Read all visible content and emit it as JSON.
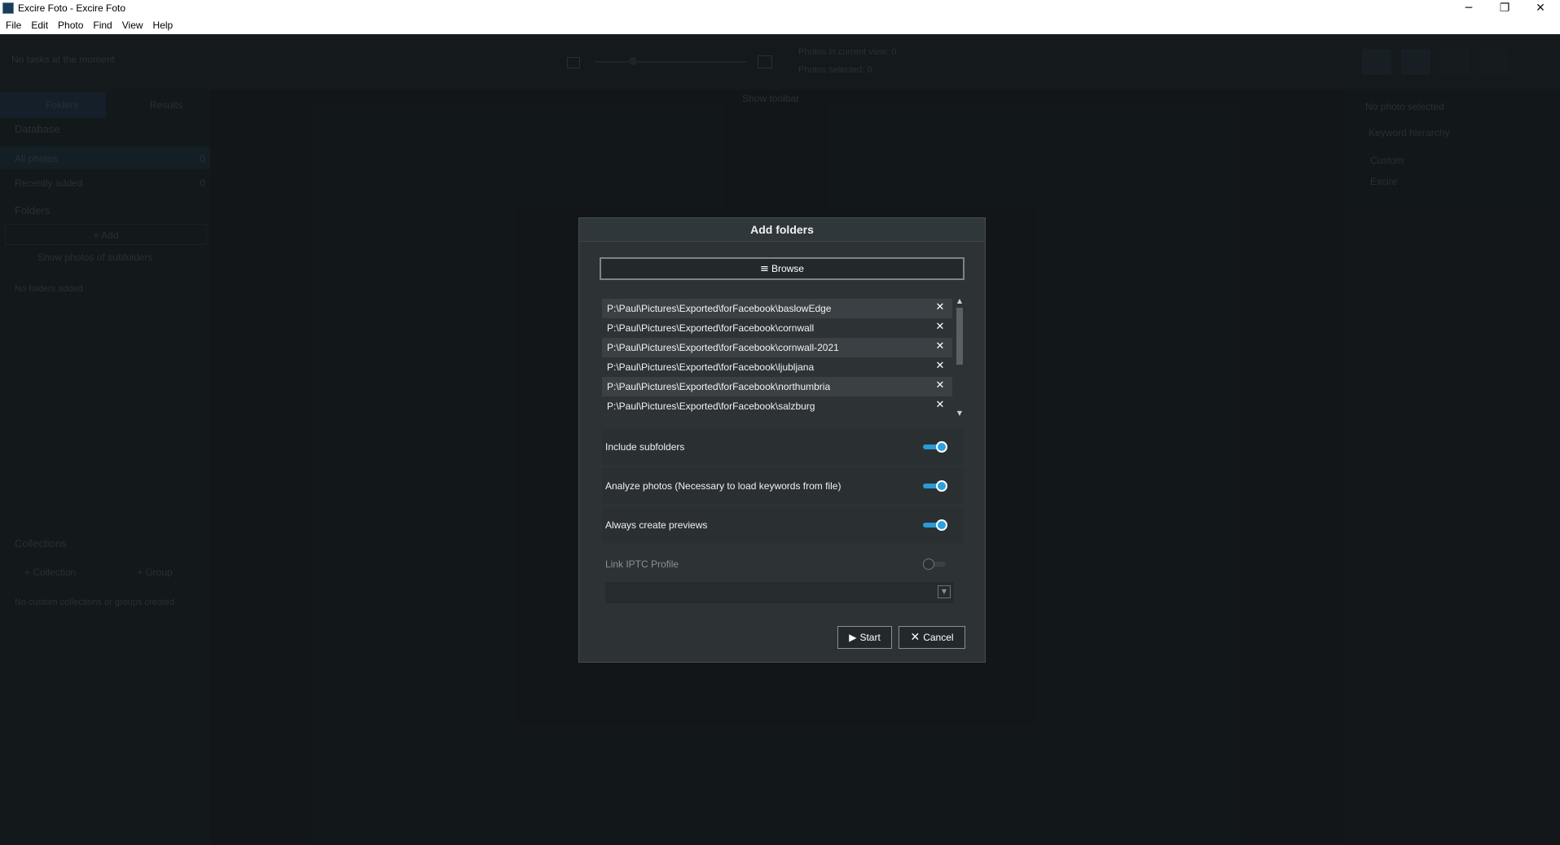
{
  "window": {
    "title": "Excire Foto - Excire Foto",
    "controls": {
      "minimize": "─",
      "maximize": "❐",
      "close": "✕"
    }
  },
  "menu": [
    "File",
    "Edit",
    "Photo",
    "Find",
    "View",
    "Help"
  ],
  "background": {
    "task_status": "No tasks at the moment",
    "photos_info": [
      "Photos in current view: 0",
      "Photos selected: 0"
    ],
    "show_toolbar": "Show toolbar",
    "left_tabs": [
      "Folders",
      "Results"
    ],
    "database_header": "Database",
    "database_items": [
      {
        "label": "All photos",
        "count": "0"
      },
      {
        "label": "Recently added",
        "count": "0"
      }
    ],
    "folders_header": "Folders",
    "add_folder": "+ Add",
    "show_subfolders": "Show photos of subfolders",
    "no_folder": "No folders added",
    "collections_header": "Collections",
    "add_collection": "+ Collection",
    "add_group": "+ Group",
    "no_collections": "No custom collections or groups created",
    "right_panel": {
      "no_selection": "No photo selected",
      "keyword_header": "Keyword hierarchy",
      "items": [
        "Custom",
        "Excire"
      ]
    }
  },
  "dialog": {
    "title": "Add folders",
    "browse_label": "Browse",
    "folders": [
      "P:\\Paul\\Pictures\\Exported\\forFacebook\\baslowEdge",
      "P:\\Paul\\Pictures\\Exported\\forFacebook\\cornwall",
      "P:\\Paul\\Pictures\\Exported\\forFacebook\\cornwall-2021",
      "P:\\Paul\\Pictures\\Exported\\forFacebook\\ljubljana",
      "P:\\Paul\\Pictures\\Exported\\forFacebook\\northumbria",
      "P:\\Paul\\Pictures\\Exported\\forFacebook\\salzburg"
    ],
    "remove_glyph": "✕",
    "options": [
      {
        "label": "Include subfolders",
        "on": true
      },
      {
        "label": "Analyze photos (Necessary to load keywords from file)",
        "on": true
      },
      {
        "label": "Always create previews",
        "on": true
      },
      {
        "label": "Link IPTC Profile",
        "on": false
      }
    ],
    "iptc_profile_value": "",
    "start_label": "Start",
    "cancel_label": "Cancel"
  },
  "colors": {
    "accent": "#2da0e0",
    "dialog_bg": "#2d3335",
    "app_bg": "#1a2022"
  }
}
